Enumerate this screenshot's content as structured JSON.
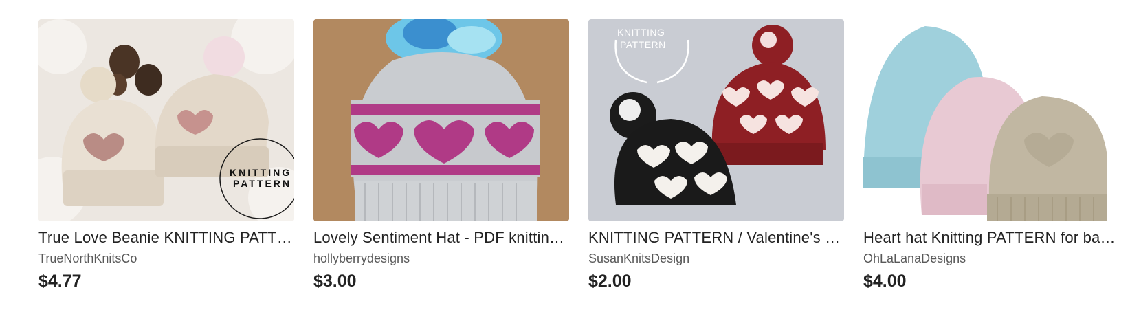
{
  "listings": [
    {
      "title": "True Love Beanie KNITTING PATTERN for baby, toddler, child, adult",
      "shop": "TrueNorthKnitsCo",
      "price": "$4.77",
      "image_text": "KNITTING PATTERN"
    },
    {
      "title": "Lovely Sentiment Hat - PDF knitting pattern",
      "shop": "hollyberrydesigns",
      "price": "$3.00"
    },
    {
      "title": "KNITTING PATTERN / Valentine's Day Heart Hat",
      "shop": "SusanKnitsDesign",
      "price": "$2.00",
      "image_text": "KNITTING PATTERN"
    },
    {
      "title": "Heart hat Knitting PATTERN for baby, toddler, child and adult",
      "shop": "OhLaLanaDesigns",
      "price": "$4.00"
    }
  ],
  "colors": {
    "text": "#222222",
    "shop_text": "#595959",
    "heart_pink": "#b03a86",
    "heart_red": "#8e1f24"
  }
}
